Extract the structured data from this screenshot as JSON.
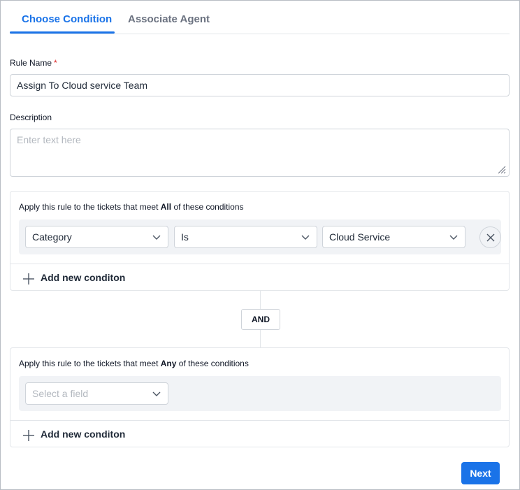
{
  "tabs": [
    {
      "label": "Choose Condition",
      "active": true
    },
    {
      "label": "Associate Agent",
      "active": false
    }
  ],
  "form": {
    "rule_name_label": "Rule Name",
    "required_mark": "*",
    "rule_name_value": "Assign To Cloud service Team",
    "description_label": "Description",
    "description_placeholder": "Enter text here"
  },
  "all_conditions": {
    "prefix": "Apply this rule to the tickets that meet ",
    "keyword": "All",
    "suffix": " of these conditions",
    "field": "Category",
    "operator": "Is",
    "value": "Cloud Service",
    "add_label": "Add new conditon"
  },
  "connector_label": "AND",
  "any_conditions": {
    "prefix": "Apply this rule to the tickets that meet ",
    "keyword": "Any",
    "suffix": " of these conditions",
    "field_placeholder": "Select a field",
    "add_label": "Add new conditon"
  },
  "next_button": "Next",
  "colors": {
    "accent": "#1a73e8",
    "required": "#dc2626",
    "border": "#cfd4da"
  },
  "icons": {
    "chevron": "chevron-down-icon",
    "close": "close-icon",
    "plus": "plus-icon",
    "resize": "resize-grip-icon"
  }
}
